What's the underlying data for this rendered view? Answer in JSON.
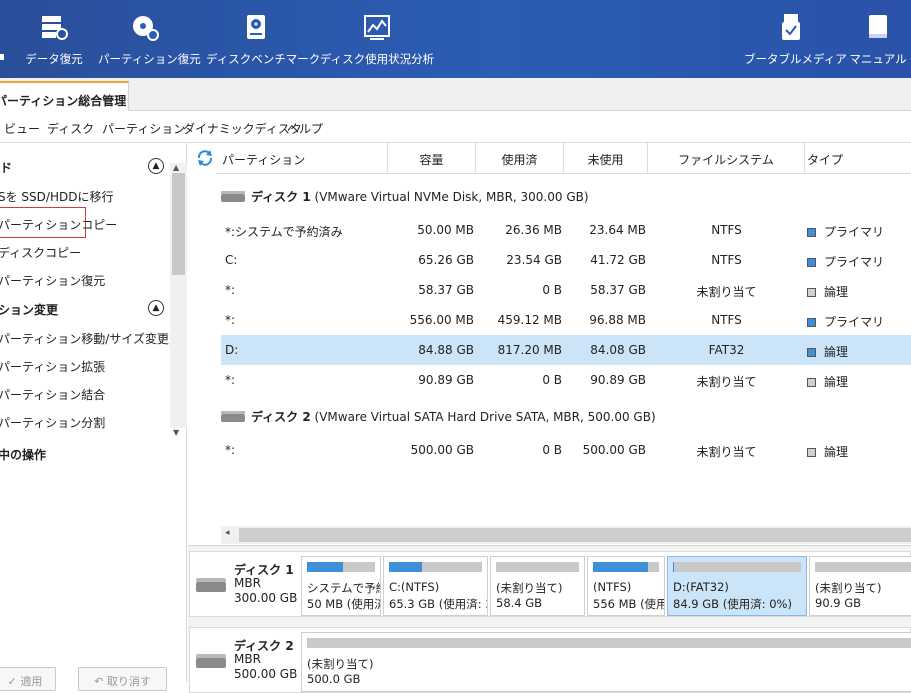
{
  "toolbar": {
    "items": [
      {
        "label": "データ復元",
        "icon": "data-recovery-icon"
      },
      {
        "label": "パーティション復元",
        "icon": "partition-recovery-icon"
      },
      {
        "label": "ディスクベンチマーク",
        "icon": "disk-benchmark-icon"
      },
      {
        "label": "ディスク使用状況分析",
        "icon": "space-analyzer-icon"
      },
      {
        "label": "ブータブルメディア",
        "icon": "bootable-media-icon"
      },
      {
        "label": "マニュアル",
        "icon": "manual-icon"
      }
    ]
  },
  "tabs": {
    "main": "パーティション総合管理"
  },
  "menu": [
    "ビュー",
    "ディスク",
    "パーティション",
    "ダイナミックディスク",
    "ヘルプ"
  ],
  "sidebar": {
    "wizard_title": "ド",
    "wizard_items": [
      "Sを SSD/HDDに移行",
      "パーティションコピー",
      "ディスクコピー",
      "パーティション復元"
    ],
    "change_title": "ション変更",
    "change_items": [
      "パーティション移動/サイズ変更",
      "パーティション拡張",
      "パーティション結合",
      "パーティション分割"
    ],
    "pending_title": "中の操作",
    "apply_button": "適用",
    "undo_button": "取り消す"
  },
  "table": {
    "headers": [
      "パーティション",
      "容量",
      "使用済",
      "未使用",
      "ファイルシステム",
      "タイプ"
    ],
    "disk1_label": "ディスク 1",
    "disk1_detail": "(VMware Virtual NVMe Disk, MBR, 300.00 GB)",
    "disk2_label": "ディスク 2",
    "disk2_detail": "(VMware Virtual SATA Hard Drive SATA, MBR, 500.00 GB)",
    "disk1_rows": [
      {
        "partition": "*:システムで予約済み",
        "capacity": "50.00 MB",
        "used": "26.36 MB",
        "unused": "23.64 MB",
        "fs": "NTFS",
        "type": "プライマリ",
        "type_color": "#3d8fd8"
      },
      {
        "partition": "C:",
        "capacity": "65.26 GB",
        "used": "23.54 GB",
        "unused": "41.72 GB",
        "fs": "NTFS",
        "type": "プライマリ",
        "type_color": "#3d8fd8"
      },
      {
        "partition": "*:",
        "capacity": "58.37 GB",
        "used": "0 B",
        "unused": "58.37 GB",
        "fs": "未割り当て",
        "type": "論理",
        "type_color": "#d0d0d0"
      },
      {
        "partition": "*:",
        "capacity": "556.00 MB",
        "used": "459.12 MB",
        "unused": "96.88 MB",
        "fs": "NTFS",
        "type": "プライマリ",
        "type_color": "#3d8fd8"
      },
      {
        "partition": "D:",
        "capacity": "84.88 GB",
        "used": "817.20 MB",
        "unused": "84.08 GB",
        "fs": "FAT32",
        "type": "論理",
        "type_color": "#3d8fd8"
      },
      {
        "partition": "*:",
        "capacity": "90.89 GB",
        "used": "0 B",
        "unused": "90.89 GB",
        "fs": "未割り当て",
        "type": "論理",
        "type_color": "#d0d0d0"
      }
    ],
    "disk2_rows": [
      {
        "partition": "*:",
        "capacity": "500.00 GB",
        "used": "0 B",
        "unused": "500.00 GB",
        "fs": "未割り当て",
        "type": "論理",
        "type_color": "#d0d0d0"
      }
    ]
  },
  "diskmap": {
    "disk1": {
      "name": "ディスク 1",
      "scheme": "MBR",
      "size": "300.00 GB"
    },
    "disk1_parts": [
      {
        "line1": "システムで予約",
        "line2": "50 MB (使用済",
        "fill": 0.53
      },
      {
        "line1": "C:(NTFS)",
        "line2": "65.3 GB (使用済: 36",
        "fill": 0.36
      },
      {
        "line1": "(未割り当て)",
        "line2": "58.4 GB",
        "fill": 0
      },
      {
        "line1": "(NTFS)",
        "line2": "556 MB (使用",
        "fill": 0.83
      },
      {
        "line1": "D:(FAT32)",
        "line2": "84.9 GB (使用済: 0%)",
        "fill": 0.01
      },
      {
        "line1": "(未割り当て)",
        "line2": "90.9 GB",
        "fill": 0
      }
    ],
    "disk2": {
      "name": "ディスク 2",
      "scheme": "MBR",
      "size": "500.00 GB"
    },
    "disk2_parts": [
      {
        "line1": "(未割り当て)",
        "line2": "500.0 GB",
        "fill": 0
      }
    ]
  }
}
